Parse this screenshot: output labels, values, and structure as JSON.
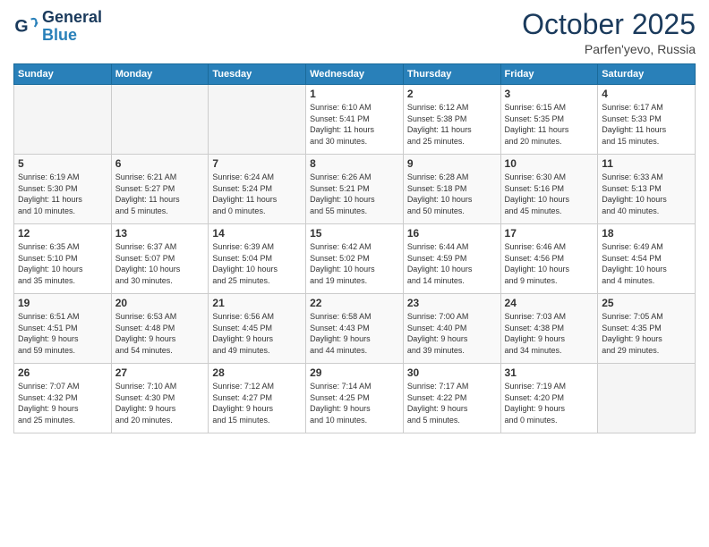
{
  "header": {
    "logo_general": "General",
    "logo_blue": "Blue",
    "month": "October 2025",
    "location": "Parfen'yevo, Russia"
  },
  "weekdays": [
    "Sunday",
    "Monday",
    "Tuesday",
    "Wednesday",
    "Thursday",
    "Friday",
    "Saturday"
  ],
  "weeks": [
    [
      {
        "day": "",
        "info": ""
      },
      {
        "day": "",
        "info": ""
      },
      {
        "day": "",
        "info": ""
      },
      {
        "day": "1",
        "info": "Sunrise: 6:10 AM\nSunset: 5:41 PM\nDaylight: 11 hours\nand 30 minutes."
      },
      {
        "day": "2",
        "info": "Sunrise: 6:12 AM\nSunset: 5:38 PM\nDaylight: 11 hours\nand 25 minutes."
      },
      {
        "day": "3",
        "info": "Sunrise: 6:15 AM\nSunset: 5:35 PM\nDaylight: 11 hours\nand 20 minutes."
      },
      {
        "day": "4",
        "info": "Sunrise: 6:17 AM\nSunset: 5:33 PM\nDaylight: 11 hours\nand 15 minutes."
      }
    ],
    [
      {
        "day": "5",
        "info": "Sunrise: 6:19 AM\nSunset: 5:30 PM\nDaylight: 11 hours\nand 10 minutes."
      },
      {
        "day": "6",
        "info": "Sunrise: 6:21 AM\nSunset: 5:27 PM\nDaylight: 11 hours\nand 5 minutes."
      },
      {
        "day": "7",
        "info": "Sunrise: 6:24 AM\nSunset: 5:24 PM\nDaylight: 11 hours\nand 0 minutes."
      },
      {
        "day": "8",
        "info": "Sunrise: 6:26 AM\nSunset: 5:21 PM\nDaylight: 10 hours\nand 55 minutes."
      },
      {
        "day": "9",
        "info": "Sunrise: 6:28 AM\nSunset: 5:18 PM\nDaylight: 10 hours\nand 50 minutes."
      },
      {
        "day": "10",
        "info": "Sunrise: 6:30 AM\nSunset: 5:16 PM\nDaylight: 10 hours\nand 45 minutes."
      },
      {
        "day": "11",
        "info": "Sunrise: 6:33 AM\nSunset: 5:13 PM\nDaylight: 10 hours\nand 40 minutes."
      }
    ],
    [
      {
        "day": "12",
        "info": "Sunrise: 6:35 AM\nSunset: 5:10 PM\nDaylight: 10 hours\nand 35 minutes."
      },
      {
        "day": "13",
        "info": "Sunrise: 6:37 AM\nSunset: 5:07 PM\nDaylight: 10 hours\nand 30 minutes."
      },
      {
        "day": "14",
        "info": "Sunrise: 6:39 AM\nSunset: 5:04 PM\nDaylight: 10 hours\nand 25 minutes."
      },
      {
        "day": "15",
        "info": "Sunrise: 6:42 AM\nSunset: 5:02 PM\nDaylight: 10 hours\nand 19 minutes."
      },
      {
        "day": "16",
        "info": "Sunrise: 6:44 AM\nSunset: 4:59 PM\nDaylight: 10 hours\nand 14 minutes."
      },
      {
        "day": "17",
        "info": "Sunrise: 6:46 AM\nSunset: 4:56 PM\nDaylight: 10 hours\nand 9 minutes."
      },
      {
        "day": "18",
        "info": "Sunrise: 6:49 AM\nSunset: 4:54 PM\nDaylight: 10 hours\nand 4 minutes."
      }
    ],
    [
      {
        "day": "19",
        "info": "Sunrise: 6:51 AM\nSunset: 4:51 PM\nDaylight: 9 hours\nand 59 minutes."
      },
      {
        "day": "20",
        "info": "Sunrise: 6:53 AM\nSunset: 4:48 PM\nDaylight: 9 hours\nand 54 minutes."
      },
      {
        "day": "21",
        "info": "Sunrise: 6:56 AM\nSunset: 4:45 PM\nDaylight: 9 hours\nand 49 minutes."
      },
      {
        "day": "22",
        "info": "Sunrise: 6:58 AM\nSunset: 4:43 PM\nDaylight: 9 hours\nand 44 minutes."
      },
      {
        "day": "23",
        "info": "Sunrise: 7:00 AM\nSunset: 4:40 PM\nDaylight: 9 hours\nand 39 minutes."
      },
      {
        "day": "24",
        "info": "Sunrise: 7:03 AM\nSunset: 4:38 PM\nDaylight: 9 hours\nand 34 minutes."
      },
      {
        "day": "25",
        "info": "Sunrise: 7:05 AM\nSunset: 4:35 PM\nDaylight: 9 hours\nand 29 minutes."
      }
    ],
    [
      {
        "day": "26",
        "info": "Sunrise: 7:07 AM\nSunset: 4:32 PM\nDaylight: 9 hours\nand 25 minutes."
      },
      {
        "day": "27",
        "info": "Sunrise: 7:10 AM\nSunset: 4:30 PM\nDaylight: 9 hours\nand 20 minutes."
      },
      {
        "day": "28",
        "info": "Sunrise: 7:12 AM\nSunset: 4:27 PM\nDaylight: 9 hours\nand 15 minutes."
      },
      {
        "day": "29",
        "info": "Sunrise: 7:14 AM\nSunset: 4:25 PM\nDaylight: 9 hours\nand 10 minutes."
      },
      {
        "day": "30",
        "info": "Sunrise: 7:17 AM\nSunset: 4:22 PM\nDaylight: 9 hours\nand 5 minutes."
      },
      {
        "day": "31",
        "info": "Sunrise: 7:19 AM\nSunset: 4:20 PM\nDaylight: 9 hours\nand 0 minutes."
      },
      {
        "day": "",
        "info": ""
      }
    ]
  ]
}
